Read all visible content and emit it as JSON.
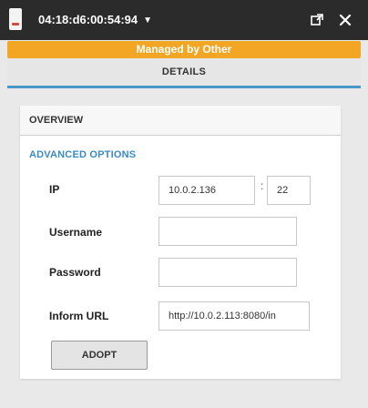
{
  "titlebar": {
    "device_icon": "device-icon",
    "title": "04:18:d6:00:54:94",
    "caret": "▼",
    "popout_icon": "popout-icon",
    "close_icon": "close-icon"
  },
  "banner": {
    "text": "Managed by Other",
    "color": "#f2a623"
  },
  "tab": {
    "label": "DETAILS",
    "accent": "#4a97c9"
  },
  "panel": {
    "overview_label": "OVERVIEW",
    "section_title": "ADVANCED OPTIONS",
    "section_color": "#3a8ac4",
    "fields": {
      "ip": {
        "label": "IP",
        "value": "10.0.2.136"
      },
      "port": {
        "separator": ":",
        "value": "22"
      },
      "username": {
        "label": "Username",
        "value": ""
      },
      "password": {
        "label": "Password",
        "value": ""
      },
      "inform_url": {
        "label": "Inform URL",
        "value": "http://10.0.2.113:8080/in"
      }
    },
    "adopt_label": "ADOPT"
  }
}
